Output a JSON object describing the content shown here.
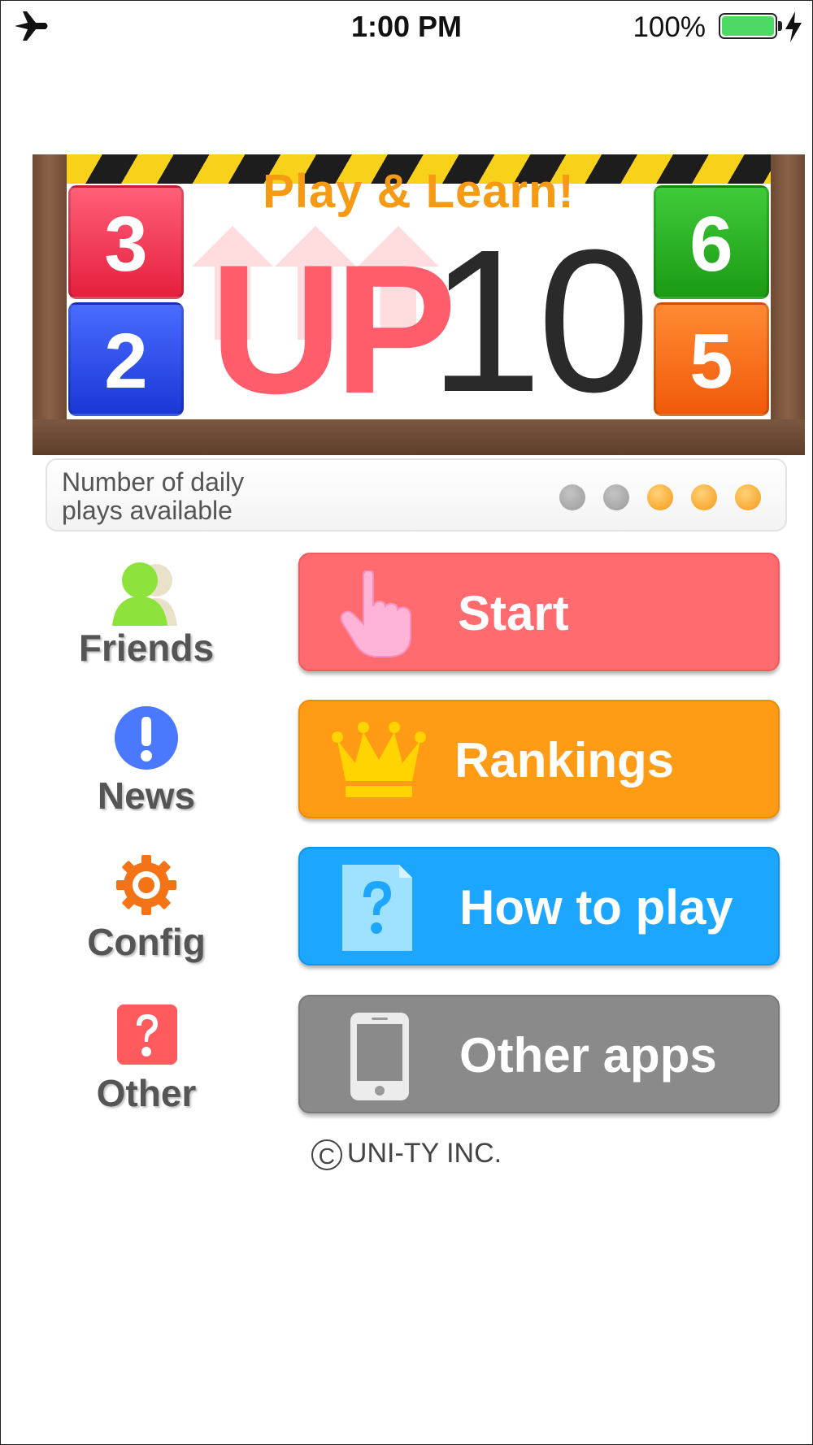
{
  "status_bar": {
    "time": "1:00 PM",
    "battery_percent": "100%"
  },
  "banner": {
    "tagline": "Play & Learn!",
    "logo_up": "UP",
    "logo_number": "10",
    "blocks": {
      "top_left": "3",
      "bottom_left": "2",
      "top_right": "6",
      "bottom_right": "5"
    }
  },
  "plays": {
    "label_line1": "Number of daily",
    "label_line2": "plays available",
    "total": 5,
    "remaining": 3
  },
  "side_menu": {
    "friends": "Friends",
    "news": "News",
    "config": "Config",
    "other": "Other"
  },
  "buttons": {
    "start": "Start",
    "rankings": "Rankings",
    "how_to_play": "How to play",
    "other_apps": "Other apps"
  },
  "colors": {
    "start": "#ff6b6e",
    "rankings": "#ff9b14",
    "how_to_play": "#1da6ff",
    "other_apps": "#8a8a8a"
  },
  "copyright": {
    "symbol": "C",
    "text": "UNI-TY INC."
  }
}
